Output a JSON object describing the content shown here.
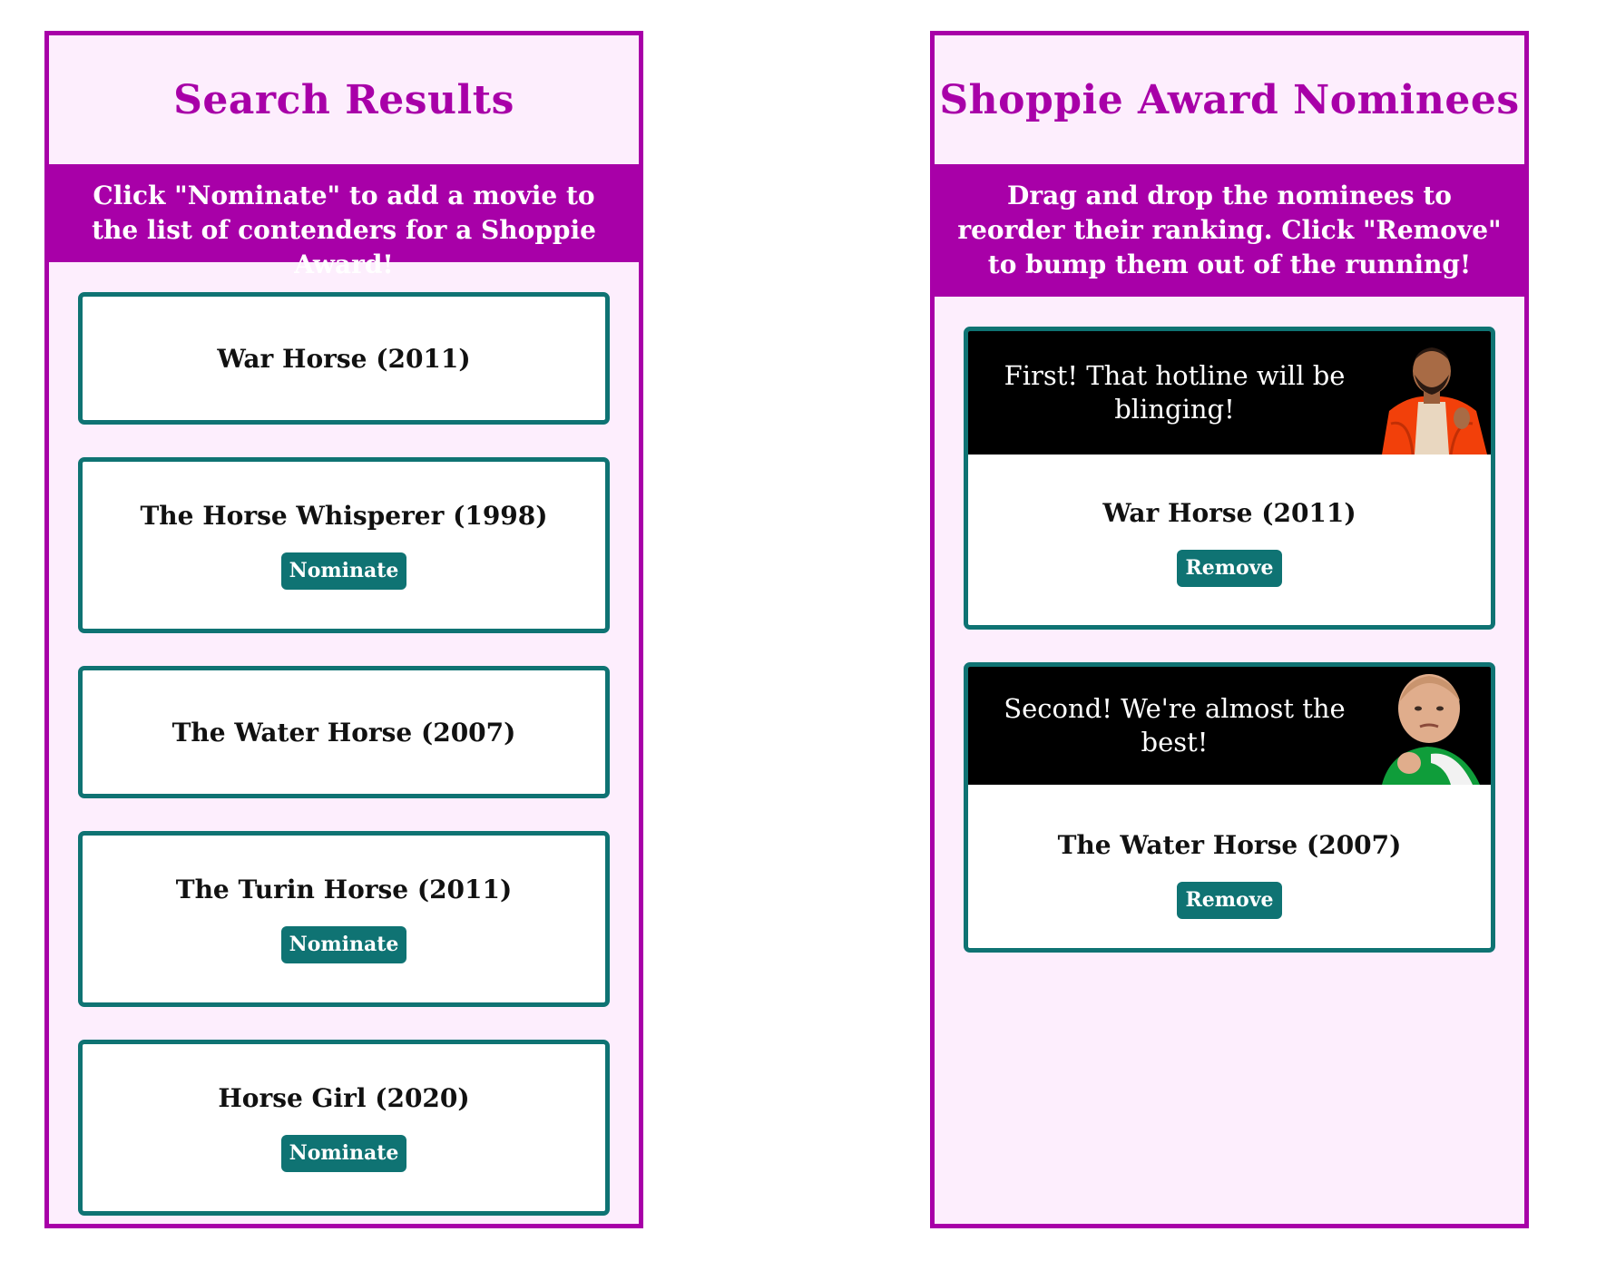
{
  "search_panel": {
    "title": "Search Results",
    "instructions": "Click \"Nominate\" to add a movie to the list of contenders for a Shoppie Award!",
    "results": [
      {
        "title": "War Horse (2011)",
        "button_label": ""
      },
      {
        "title": "The Horse Whisperer (1998)",
        "button_label": "Nominate"
      },
      {
        "title": "The Water Horse (2007)",
        "button_label": ""
      },
      {
        "title": "The Turin Horse (2011)",
        "button_label": "Nominate"
      },
      {
        "title": "Horse Girl (2020)",
        "button_label": "Nominate"
      }
    ]
  },
  "nominees_panel": {
    "title": "Shoppie Award Nominees",
    "instructions": "Drag and drop the nominees to reorder their ranking. Click \"Remove\" to bump them out of the running!",
    "nominees": [
      {
        "banner_text": "First! That hotline will be blinging!",
        "banner_image": "rapper-in-orange-jacket-image",
        "title": "War Horse (2011)",
        "button_label": "Remove"
      },
      {
        "banner_text": "Second! We're almost the best!",
        "banner_image": "success-kid-fist-image",
        "title": "The Water Horse (2007)",
        "button_label": "Remove"
      }
    ]
  },
  "colors": {
    "accent": "#a800a8",
    "panel_background": "#fdeefd",
    "card_border": "#0f7373",
    "button_background": "#0f7373"
  }
}
